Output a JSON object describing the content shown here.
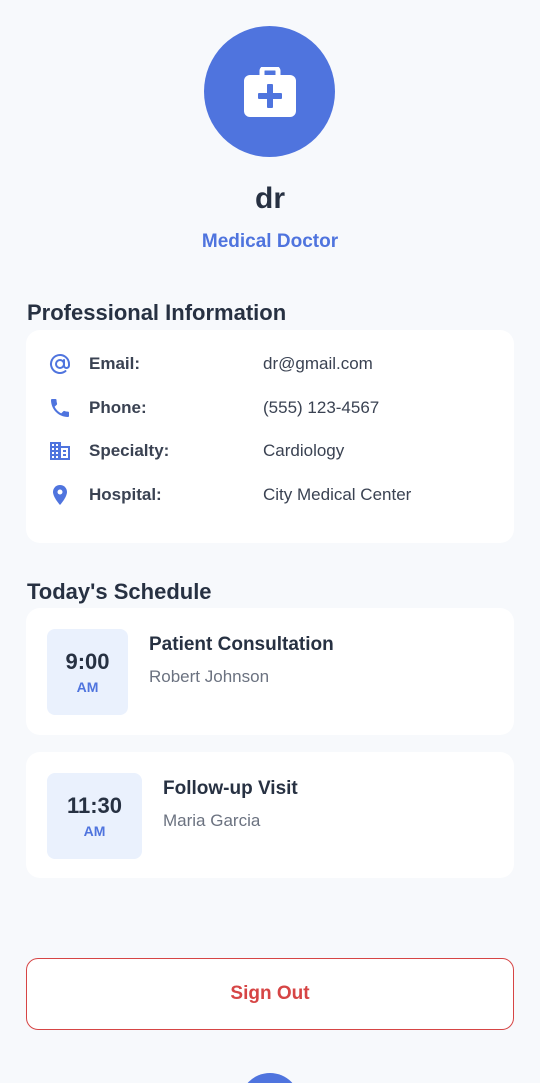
{
  "profile": {
    "name": "dr",
    "role": "Medical Doctor",
    "avatar_icon": "medical-kit-icon"
  },
  "professional_info": {
    "title": "Professional Information",
    "rows": [
      {
        "icon": "at-icon",
        "label": "Email:",
        "value": "dr@gmail.com"
      },
      {
        "icon": "phone-icon",
        "label": "Phone:",
        "value": "(555) 123-4567"
      },
      {
        "icon": "building-icon",
        "label": "Specialty:",
        "value": "Cardiology"
      },
      {
        "icon": "location-pin-icon",
        "label": "Hospital:",
        "value": "City Medical Center"
      }
    ]
  },
  "schedule": {
    "title": "Today's Schedule",
    "appointments": [
      {
        "time": "9:00",
        "ampm": "AM",
        "title": "Patient Consultation",
        "patient": "Robert Johnson"
      },
      {
        "time": "11:30",
        "ampm": "AM",
        "title": "Follow-up Visit",
        "patient": "Maria Garcia"
      }
    ]
  },
  "actions": {
    "sign_out_label": "Sign Out"
  },
  "colors": {
    "accent": "#4f74de",
    "danger": "#d64545",
    "background": "#f7f9fc",
    "time_box": "#eaf1fd"
  }
}
